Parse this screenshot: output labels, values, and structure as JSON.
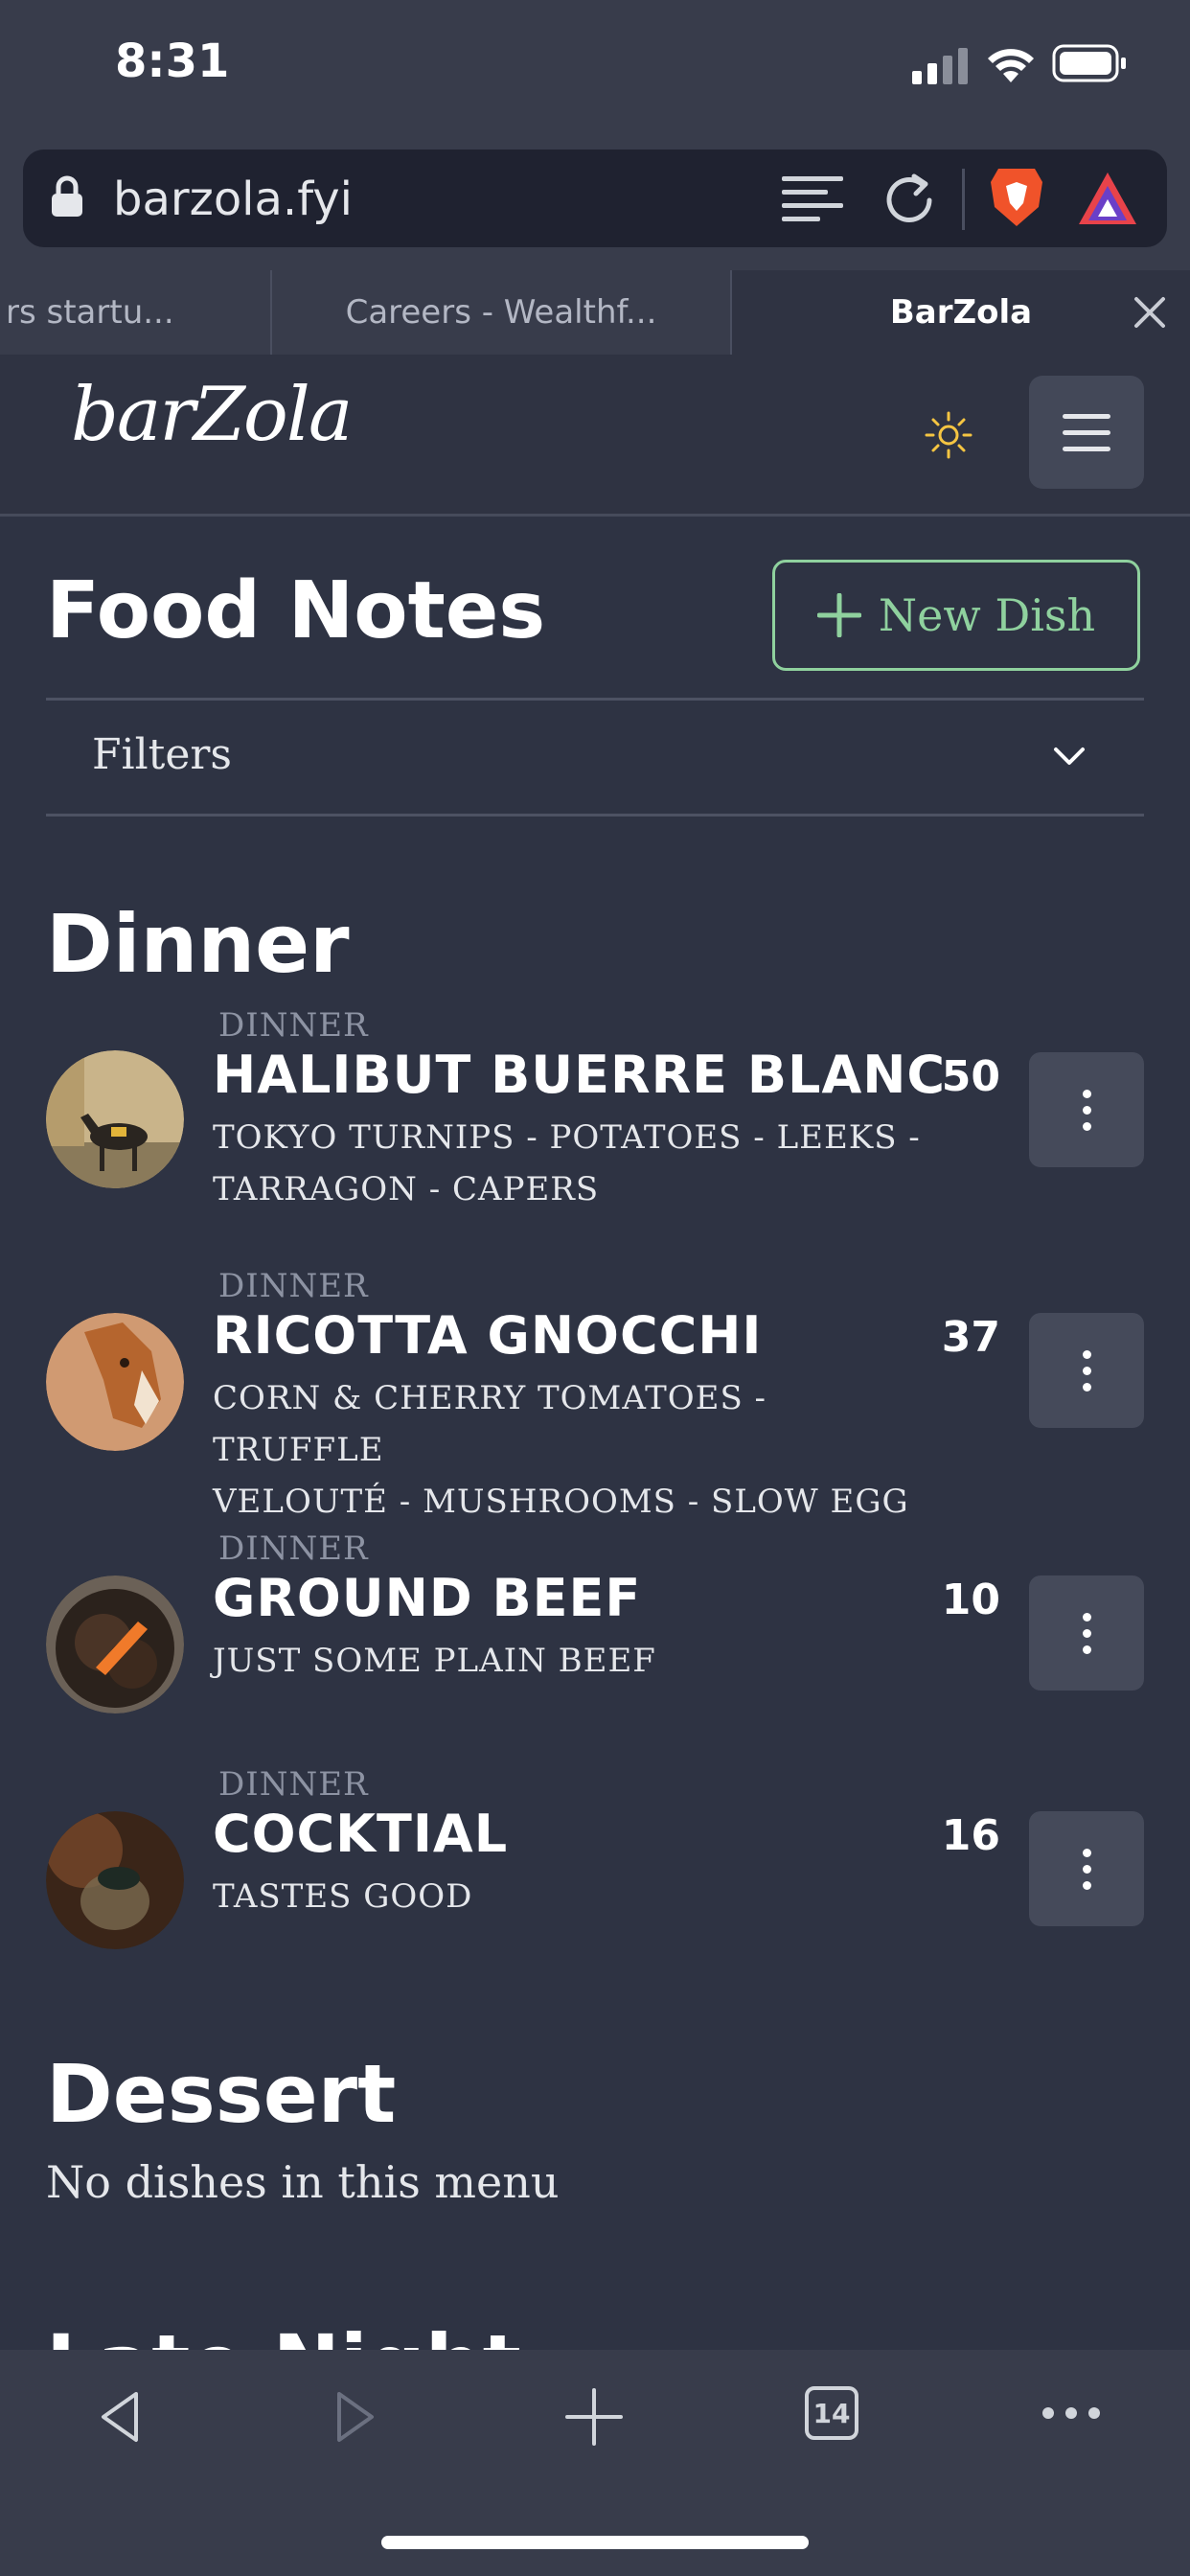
{
  "status_bar": {
    "time": "8:31"
  },
  "browser": {
    "url": "barzola.fyi",
    "tabs": [
      {
        "label": "rs startu..."
      },
      {
        "label": "Careers - Wealthf..."
      },
      {
        "label": "BarZola"
      }
    ],
    "tab_count": "14"
  },
  "site": {
    "logo": "barZola"
  },
  "page": {
    "title": "Food Notes",
    "new_dish_label": "New Dish",
    "filters_label": "Filters"
  },
  "sections": [
    {
      "title": "Dinner",
      "dishes": [
        {
          "category": "DINNER",
          "name": "HALIBUT BUERRE BLANC",
          "desc_line1": "TOKYO TURNIPS - POTATOES - LEEKS -",
          "desc_line2": "TARRAGON - CAPERS",
          "count": "50"
        },
        {
          "category": "DINNER",
          "name": "RICOTTA GNOCCHI",
          "desc_line1": "CORN & CHERRY TOMATOES - TRUFFLE",
          "desc_line2": "VELOUTÉ - MUSHROOMS - SLOW EGG",
          "count": "37"
        },
        {
          "category": "DINNER",
          "name": "GROUND BEEF",
          "desc_line1": "JUST SOME PLAIN BEEF",
          "count": "10"
        },
        {
          "category": "DINNER",
          "name": "COCKTIAL",
          "desc_line1": "TASTES GOOD",
          "count": "16"
        }
      ]
    },
    {
      "title": "Dessert",
      "empty_text": "No dishes in this menu"
    },
    {
      "title": "Late Night"
    }
  ],
  "colors": {
    "background": "#2e3343",
    "accent": "#8fd19e",
    "chrome": "#383c4b"
  }
}
